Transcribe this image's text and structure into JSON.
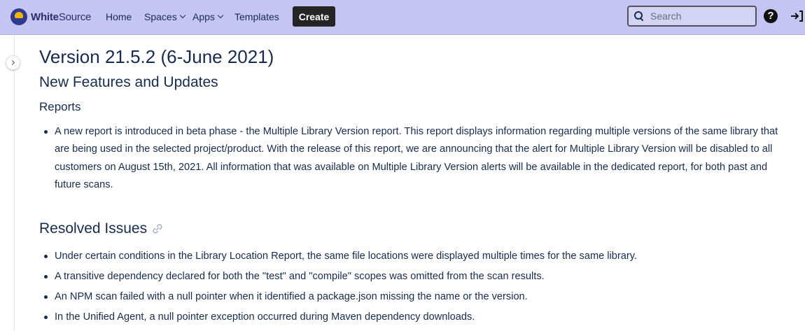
{
  "header": {
    "logo_prefix": "White",
    "logo_suffix": "Source",
    "nav": {
      "home": "Home",
      "spaces": "Spaces",
      "apps": "Apps",
      "templates": "Templates"
    },
    "create_label": "Create",
    "search_placeholder": "Search"
  },
  "page": {
    "title": "Version 21.5.2 (6-June 2021)",
    "section_new": "New Features and Updates",
    "subsection_reports": "Reports",
    "reports_items": [
      "A new report is introduced in beta phase - the Multiple Library Version report. This report displays information regarding multiple versions of the same library that are being used in the selected project/product. With the release of this report, we are announcing that the alert for Multiple Library Version will be disabled to all customers on August 15th, 2021. All information that was available on Multiple Library Version alerts will be available in the dedicated report, for both past and future scans."
    ],
    "section_resolved": "Resolved Issues",
    "resolved_items": [
      "Under certain conditions in the Library Location Report, the same file locations were displayed multiple times for the same library.",
      "A transitive dependency declared for both the \"test\" and \"compile\" scopes was omitted from the scan results.",
      "An NPM scan failed with a null pointer when it identified a package.json missing the name or the version.",
      "In the Unified Agent, a null pointer exception occurred during Maven dependency downloads."
    ]
  },
  "icons": {
    "logo": "whitesource-logo-icon",
    "search": "search-icon",
    "help": "help-icon",
    "login": "login-icon",
    "expand": "chevron-right-icon",
    "link": "link-icon"
  },
  "colors": {
    "header_bg": "#c5c5f3",
    "create_bg": "#252526",
    "text": "#172b4d"
  }
}
